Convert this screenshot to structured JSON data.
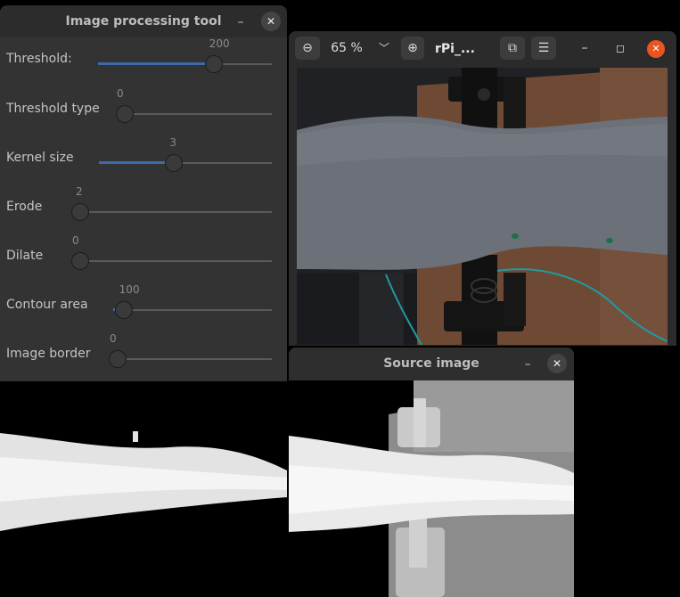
{
  "tool_window": {
    "title": "Image processing tool",
    "minimize_glyph": "–",
    "close_glyph": "✕",
    "controls": [
      {
        "label": "Threshold:",
        "value": "200",
        "fraction": 0.66
      },
      {
        "label": "Threshold type",
        "value": "0",
        "fraction": 0.0
      },
      {
        "label": "Kernel size",
        "value": "3",
        "fraction": 0.43
      },
      {
        "label": "Erode",
        "value": "2",
        "fraction": 0.04
      },
      {
        "label": "Dilate",
        "value": "0",
        "fraction": 0.0
      },
      {
        "label": "Contour area",
        "value": "100",
        "fraction": 0.06
      },
      {
        "label": "Image border",
        "value": "0",
        "fraction": 0.0
      }
    ]
  },
  "viewer_window": {
    "zoom_out_glyph": "⊖",
    "zoom_level": "65 %",
    "zoom_menu_glyph": "﹀",
    "zoom_in_glyph": "⊕",
    "title": "rPi_...",
    "rotate_glyph": "⧉",
    "menu_glyph": "☰",
    "minimize_glyph": "–",
    "maximize_glyph": "◻",
    "close_glyph": "✕"
  },
  "source_window": {
    "title": "Source image",
    "minimize_glyph": "–",
    "close_glyph": "✕"
  },
  "colors": {
    "accent": "#3d6aa8",
    "viewer_close": "#e95420",
    "panel": "#333333"
  }
}
